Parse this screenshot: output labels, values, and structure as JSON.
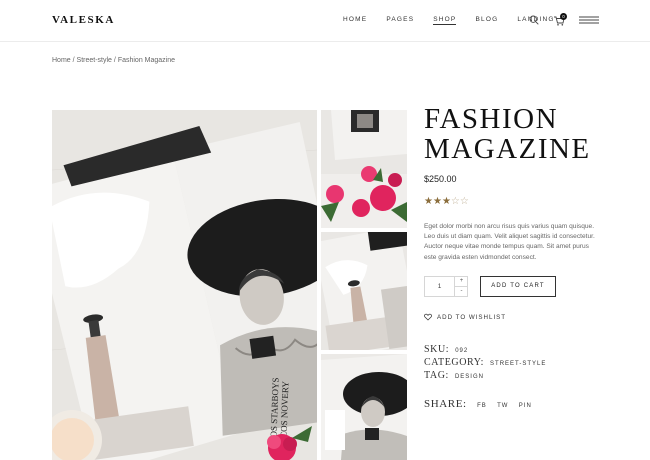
{
  "header": {
    "logo": "VALESKA",
    "nav": [
      "HOME",
      "PAGES",
      "SHOP",
      "BLOG",
      "LANDING"
    ],
    "active_nav": "SHOP",
    "cart_count": "0",
    "icons": [
      "search-icon",
      "cart-icon",
      "hamburger-menu-icon"
    ]
  },
  "breadcrumb": {
    "home": "Home",
    "separator": "/",
    "category": "Street-style",
    "current": "Fashion Magazine"
  },
  "product": {
    "title_line1": "FASHION",
    "title_line2": "MAGAZINE",
    "price": "$250.00",
    "rating": 3,
    "rating_max": 5,
    "description": "Eget dolor morbi non arcu risus quis varius quam quisque. Leo duis ut diam quam. Velit aliquet sagittis id consectetur. Auctor neque vitae monde tempus quam. Sit amet purus este gravida esten vidmondet consect.",
    "quantity": "1",
    "qty_up": "+",
    "qty_down": "-",
    "add_to_cart": "ADD TO CART",
    "wishlist": "ADD TO WISHLIST",
    "sku_label": "SKU:",
    "sku_value": "092",
    "category_label": "CATEGORY:",
    "category_value": "STREET-STYLE",
    "tag_label": "TAG:",
    "tag_value": "DESIGN",
    "share_label": "SHARE:",
    "share_links": [
      "FB",
      "TW",
      "PIN"
    ]
  },
  "colors": {
    "star": "#8a6d3b",
    "text": "#222222",
    "accent_pink": "#e0245e"
  }
}
